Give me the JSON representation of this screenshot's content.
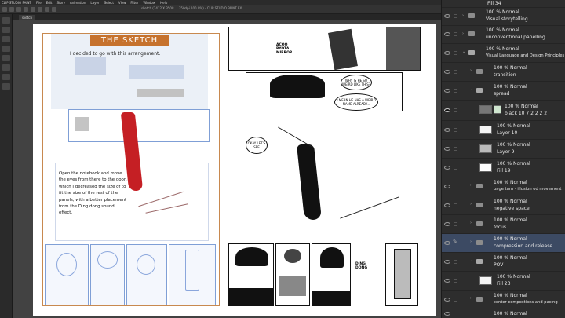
{
  "app": {
    "name": "CLIP STUDIO PAINT",
    "menus": [
      "File",
      "Edit",
      "Story",
      "Animation",
      "Layer",
      "Select",
      "View",
      "Filter",
      "Window",
      "Help"
    ],
    "title": "sketch (2412 X 3508 ... 350dpi 100.0%) - CLIP STUDIO PAINT EX",
    "tab": "sketch"
  },
  "page_left": {
    "banner": "THE SKETCH",
    "caption": "I decided to go with this arrangement.",
    "narration": "Open the notebook and move the eyes from there to the door, which I decreased the size of to fit the size of the rest of the panels, with a better placement from the Ding dong sound effect."
  },
  "page_right": {
    "sfx_top": "ACOO RYOTA MIRROR",
    "bubble1": "WHY IS HE SO WEIRD LIKE THIS?",
    "bubble2": "I MEAN HE HAS A WEIRD NAME ALREADY...",
    "bubble3": "OKAY LET'S SEE",
    "sfx_ding": "DING DONG"
  },
  "layers": {
    "accent": "#3c4a63",
    "rows": [
      {
        "mode": "Fill 34",
        "name": ""
      },
      {
        "mode": "100 % Normal",
        "name": "Visual storytelling"
      },
      {
        "mode": "100 % Normal",
        "name": "unconventional panelling"
      },
      {
        "mode": "100 % Normal",
        "name": "Visual Language and Design Principles"
      },
      {
        "mode": "100 % Normal",
        "name": "transition"
      },
      {
        "mode": "100 % Normal",
        "name": "spread"
      },
      {
        "mode": "100 % Normal",
        "name": "black 10 7 2 2 2 2"
      },
      {
        "mode": "100 % Normal",
        "name": "Layer 10"
      },
      {
        "mode": "100 % Normal",
        "name": "Layer 9"
      },
      {
        "mode": "100 % Normal",
        "name": "Fill 19"
      },
      {
        "mode": "100 % Normal",
        "name": "page turn - illusion od movement"
      },
      {
        "mode": "100 % Normal",
        "name": "negative space"
      },
      {
        "mode": "100 % Normal",
        "name": "focus"
      },
      {
        "mode": "100 % Normal",
        "name": "compression and release"
      },
      {
        "mode": "100 % Normal",
        "name": "POV"
      },
      {
        "mode": "100 % Normal",
        "name": "Fill 23"
      },
      {
        "mode": "100 % Normal",
        "name": "center compostions and pacing"
      },
      {
        "mode": "100 % Normal",
        "name": ""
      }
    ]
  }
}
